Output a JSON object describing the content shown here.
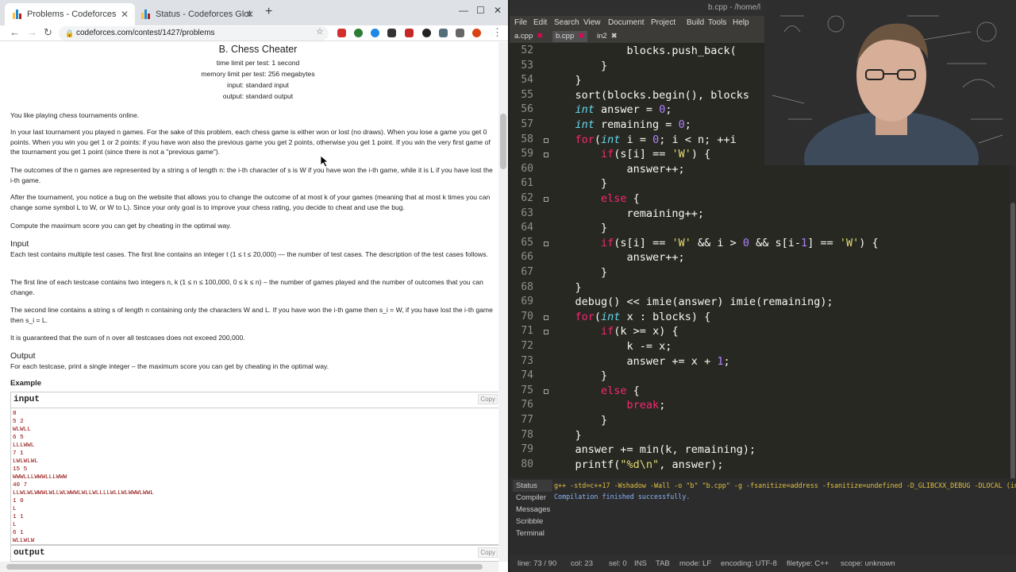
{
  "browser": {
    "tabs": [
      {
        "title": "Problems - Codeforces",
        "active": true
      },
      {
        "title": "Status - Codeforces Glob",
        "active": false
      }
    ],
    "url": "codeforces.com/contest/1427/problems"
  },
  "problem": {
    "title": "B. Chess Cheater",
    "time_limit": "time limit per test: 1 second",
    "memory_limit": "memory limit per test: 256 megabytes",
    "input_file": "input: standard input",
    "output_file": "output: standard output",
    "statement": [
      "You like playing chess tournaments online.",
      "In your last tournament you played n games. For the sake of this problem, each chess game is either won or lost (no draws). When you lose a game you get 0 points. When you win you get 1 or 2 points: if you have won also the previous game you get 2 points, otherwise you get 1 point. If you win the very first game of the tournament you get 1 point (since there is not a \"previous game\").",
      "The outcomes of the n games are represented by a string s of length n: the i-th character of s is W if you have won the i-th game, while it is L if you have lost the i-th game.",
      "After the tournament, you notice a bug on the website that allows you to change the outcome of at most k of your games (meaning that at most k times you can change some symbol L to W, or W to L). Since your only goal is to improve your chess rating, you decide to cheat and use the bug.",
      "Compute the maximum score you can get by cheating in the optimal way."
    ],
    "input_heading": "Input",
    "input_spec": [
      "Each test contains multiple test cases. The first line contains an integer t (1 ≤ t ≤ 20,000) — the number of test cases. The description of the test cases follows.",
      "The first line of each testcase contains two integers n, k (1 ≤ n ≤ 100,000, 0 ≤ k ≤ n) – the number of games played and the number of outcomes that you can change.",
      "The second line contains a string s of length n containing only the characters W and L. If you have won the i-th game then s_i = W, if you have lost the i-th game then s_i = L.",
      "It is guaranteed that the sum of n over all testcases does not exceed 200,000."
    ],
    "output_heading": "Output",
    "output_spec": "For each testcase, print a single integer – the maximum score you can get by cheating in the optimal way.",
    "example_heading": "Example",
    "sample_input_label": "input",
    "sample_output_label": "output",
    "copy_label": "Copy",
    "sample_input": "8\n5 2\nWLWLL\n6 5\nLLLWWL\n7 1\nLWLWLWL\n15 5\nWWWLLLWWWLLLWWW\n40 7\nLLWLWLWWWLWLLWLWWWLWLLWLLLLWLLWLWWWLWWL\n1 0\nL\n1 1\nL\n6 1\nWLLWLW"
  },
  "editor": {
    "title": "b.cpp - /home/l",
    "menu": [
      "File",
      "Edit",
      "Search",
      "View",
      "Document",
      "Project",
      "Build",
      "Tools",
      "Help"
    ],
    "file_tabs": [
      "a.cpp",
      "b.cpp",
      "in2"
    ],
    "code_lines": [
      {
        "n": "52",
        "t": "            blocks.push_back("
      },
      {
        "n": "53",
        "t": "        }"
      },
      {
        "n": "54",
        "t": "    }"
      },
      {
        "n": "55",
        "t": "    sort(blocks.begin(), blocks"
      },
      {
        "n": "56",
        "t": "    int answer = 0;"
      },
      {
        "n": "57",
        "t": "    int remaining = 0;"
      },
      {
        "n": "58",
        "t": "    for(int i = 0; i < n; ++i"
      },
      {
        "n": "59",
        "t": "        if(s[i] == 'W') {"
      },
      {
        "n": "60",
        "t": "            answer++;"
      },
      {
        "n": "61",
        "t": "        }"
      },
      {
        "n": "62",
        "t": "        else {"
      },
      {
        "n": "63",
        "t": "            remaining++;"
      },
      {
        "n": "64",
        "t": "        }"
      },
      {
        "n": "65",
        "t": "        if(s[i] == 'W' && i > 0 && s[i-1] == 'W') {"
      },
      {
        "n": "66",
        "t": "            answer++;"
      },
      {
        "n": "67",
        "t": "        }"
      },
      {
        "n": "68",
        "t": "    }"
      },
      {
        "n": "69",
        "t": "    debug() << imie(answer) imie(remaining);"
      },
      {
        "n": "70",
        "t": "    for(int x : blocks) {"
      },
      {
        "n": "71",
        "t": "        if(k >= x) {"
      },
      {
        "n": "72",
        "t": "            k -= x;"
      },
      {
        "n": "73",
        "t": "            answer += x + 1;"
      },
      {
        "n": "74",
        "t": "        }"
      },
      {
        "n": "75",
        "t": "        else {"
      },
      {
        "n": "76",
        "t": "            break;"
      },
      {
        "n": "77",
        "t": "        }"
      },
      {
        "n": "78",
        "t": "    }"
      },
      {
        "n": "79",
        "t": "    answer += min(k, remaining);"
      },
      {
        "n": "80",
        "t": "    printf(\"%d\\n\", answer);"
      }
    ],
    "panel_tabs": [
      "Status",
      "Compiler",
      "Messages",
      "Scribble",
      "Terminal"
    ],
    "compiler_cmd": "g++ -std=c++17 -Wshadow -Wall -o \"b\" \"b.cpp\" -g -fsanitize=address -fsanitize=undefined -D_GLIBCXX_DEBUG -DLOCAL (in director",
    "compiler_result": "Compilation finished successfully.",
    "status": {
      "line": "line: 73 / 90",
      "col": "col: 23",
      "sel": "sel: 0",
      "ins": "INS",
      "tab": "TAB",
      "mode": "mode: LF",
      "encoding": "encoding: UTF-8",
      "filetype": "filetype: C++",
      "scope": "scope: unknown"
    }
  }
}
